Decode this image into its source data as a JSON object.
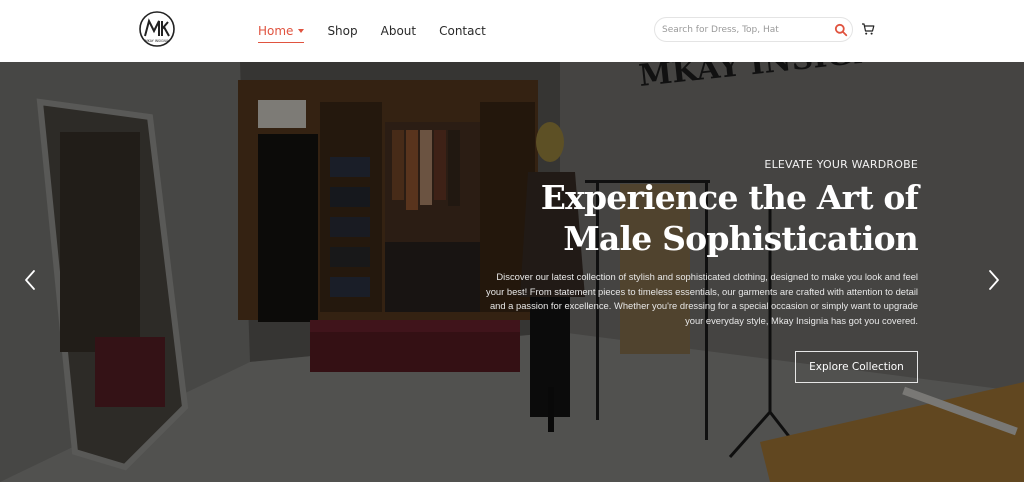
{
  "brand": {
    "logo_text": "MKAY INSIGNIA"
  },
  "nav": {
    "items": [
      {
        "label": "Home",
        "active": true,
        "has_dropdown": true
      },
      {
        "label": "Shop"
      },
      {
        "label": "About"
      },
      {
        "label": "Contact"
      }
    ]
  },
  "search": {
    "placeholder": "Search for Dress, Top, Hat",
    "value": "",
    "icon": "search-icon"
  },
  "cart": {
    "icon": "cart-icon"
  },
  "hero": {
    "eyebrow": "ELEVATE YOUR WARDROBE",
    "headline_line1": "Experience the Art of",
    "headline_line2": "Male Sophistication",
    "description": "Discover our latest collection of stylish and sophisticated clothing, designed to make you look and feel your best! From statement pieces to timeless essentials, our garments are crafted with attention to detail and a passion for excellence. Whether you're dressing for a special occasion or simply want to upgrade your everyday style, Mkay Insignia has got you covered.",
    "cta_label": "Explore Collection",
    "prev_icon": "chevron-left-icon",
    "next_icon": "chevron-right-icon",
    "background_sign": "MKAY INSIGNIA"
  },
  "colors": {
    "accent": "#e0533f",
    "header_bg": "#ffffff",
    "overlay": "rgba(0,0,0,0.42)"
  }
}
